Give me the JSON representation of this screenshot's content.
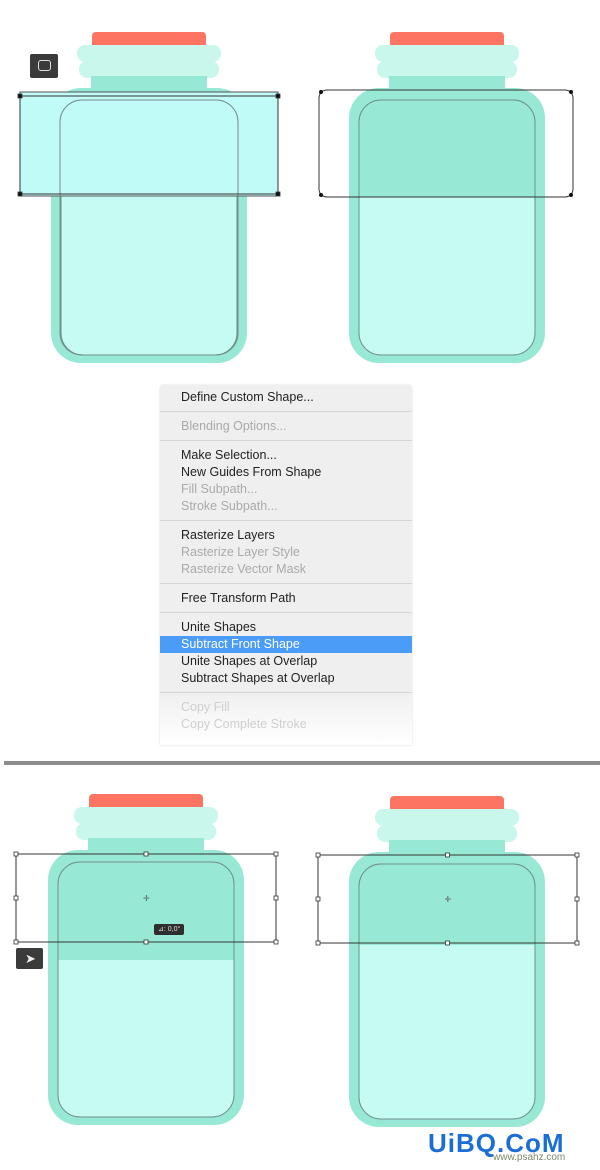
{
  "colors": {
    "cap": "#fd7462",
    "lid": "#c9f7ec",
    "body": "#98e8d6",
    "fill": "#c6fbf4",
    "selection": "#c0fbf7",
    "menu_highlight": "#4a9cf6"
  },
  "context_menu": {
    "items": [
      {
        "label": "Define Custom Shape...",
        "enabled": true
      },
      {
        "separator": true
      },
      {
        "label": "Blending Options...",
        "enabled": false
      },
      {
        "separator": true
      },
      {
        "label": "Make Selection...",
        "enabled": true
      },
      {
        "label": "New Guides From Shape",
        "enabled": true
      },
      {
        "label": "Fill Subpath...",
        "enabled": false
      },
      {
        "label": "Stroke Subpath...",
        "enabled": false
      },
      {
        "separator": true
      },
      {
        "label": "Rasterize Layers",
        "enabled": true
      },
      {
        "label": "Rasterize Layer Style",
        "enabled": false
      },
      {
        "label": "Rasterize Vector Mask",
        "enabled": false
      },
      {
        "separator": true
      },
      {
        "label": "Free Transform Path",
        "enabled": true
      },
      {
        "separator": true
      },
      {
        "label": "Unite Shapes",
        "enabled": true
      },
      {
        "label": "Subtract Front Shape",
        "enabled": true,
        "selected": true
      },
      {
        "label": "Unite Shapes at Overlap",
        "enabled": true
      },
      {
        "label": "Subtract Shapes at Overlap",
        "enabled": true
      },
      {
        "separator": true
      },
      {
        "label": "Copy Fill",
        "enabled": false
      },
      {
        "label": "Copy Complete Stroke",
        "enabled": false
      }
    ]
  },
  "tools": {
    "top": "rounded-rectangle-tool-icon",
    "bottom": "path-selection-tool-icon"
  },
  "angle_tooltip": "⊿: 0,0°",
  "watermark": {
    "logo": "UiBQ.CoM",
    "url": "www.psahz.com"
  }
}
